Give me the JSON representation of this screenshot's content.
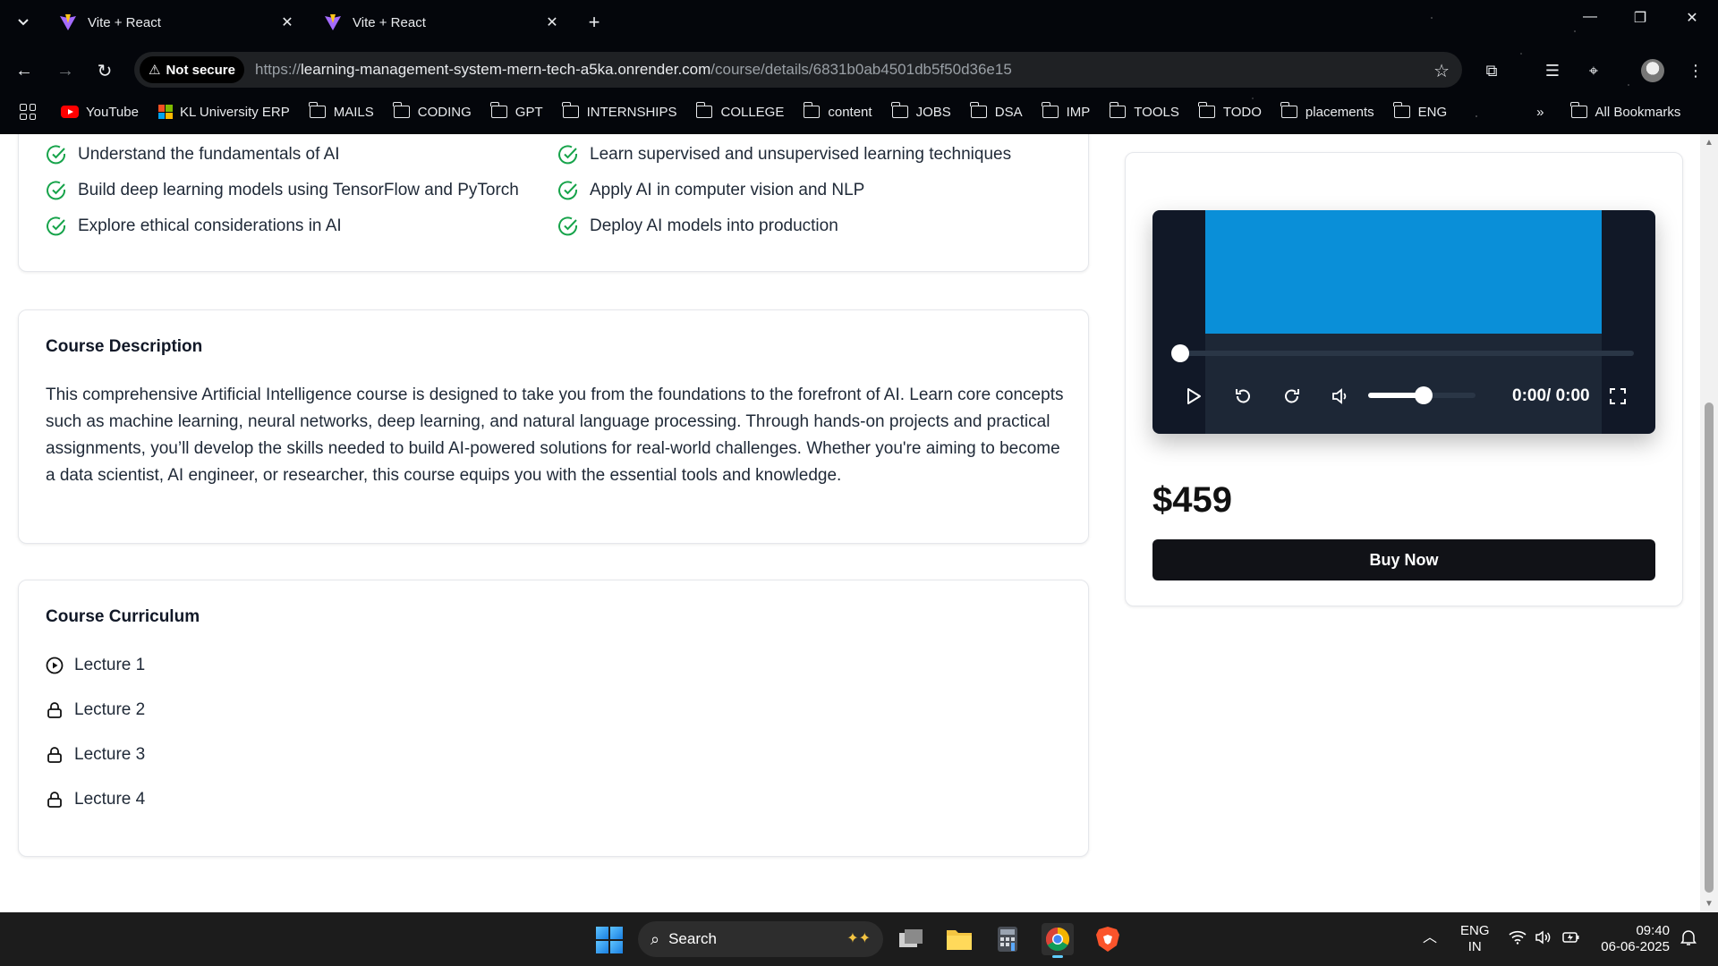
{
  "browser": {
    "tabs": [
      {
        "title": "Vite + React"
      },
      {
        "title": "Vite + React"
      }
    ],
    "security_label": "Not secure",
    "url_scheme": "https://",
    "url_host": "learning-management-system-mern-tech-a5ka.onrender.com",
    "url_path": "/course/details/6831b0ab4501db5f50d36e15",
    "bookmarks": [
      "YouTube",
      "KL University ERP",
      "MAILS",
      "CODING",
      "GPT",
      "INTERNSHIPS",
      "COLLEGE",
      "content",
      "JOBS",
      "DSA",
      "IMP",
      "TOOLS",
      "TODO",
      "placements",
      "ENG"
    ],
    "all_bookmarks": "All Bookmarks"
  },
  "course": {
    "learn": [
      "Understand the fundamentals of AI",
      "Learn supervised and unsupervised learning techniques",
      "Build deep learning models using TensorFlow and PyTorch",
      "Apply AI in computer vision and NLP",
      "Explore ethical considerations in AI",
      "Deploy AI models into production"
    ],
    "description_title": "Course Description",
    "description": "This comprehensive Artificial Intelligence course is designed to take you from the foundations to the forefront of AI. Learn core concepts such as machine learning, neural networks, deep learning, and natural language processing. Through hands-on projects and practical assignments, you’ll develop the skills needed to build AI-powered solutions for real-world challenges. Whether you're aiming to become a data scientist, AI engineer, or researcher, this course equips you with the essential tools and knowledge.",
    "curriculum_title": "Course Curriculum",
    "lectures": [
      {
        "title": "Lecture 1",
        "locked": false
      },
      {
        "title": "Lecture 2",
        "locked": true
      },
      {
        "title": "Lecture 3",
        "locked": true
      },
      {
        "title": "Lecture 4",
        "locked": true
      }
    ],
    "player": {
      "time": "0:00/ 0:00",
      "progress": 0,
      "volume": 0.5
    },
    "price": "$459",
    "buy_label": "Buy Now"
  },
  "taskbar": {
    "search_placeholder": "Search",
    "lang_line1": "ENG",
    "lang_line2": "IN",
    "time": "09:40",
    "date": "06-06-2025"
  },
  "colors": {
    "accent_check": "#16a34a",
    "video_screen": "#0a8fd8",
    "button_bg": "#111217"
  }
}
